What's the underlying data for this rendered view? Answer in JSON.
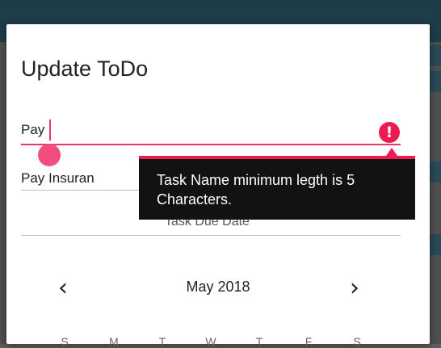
{
  "dialog": {
    "title": "Update ToDo",
    "task_name_value": "Pay",
    "task_description_value": "Pay Insuran",
    "due_date_label": "Task Due Date",
    "error_icon": "exclamation-icon",
    "error_tooltip_line1": "Task Name minimum legth is 5",
    "error_tooltip_line2": "Characters."
  },
  "calendar": {
    "month_label": "May 2018",
    "prev_icon": "chevron-left-icon",
    "next_icon": "chevron-right-icon",
    "weekdays": [
      "S",
      "M",
      "T",
      "W",
      "T",
      "F",
      "S"
    ]
  },
  "colors": {
    "accent": "#e8396e",
    "error": "#ec1c53",
    "tooltip_bg": "#121212",
    "appbar": "#1d3d49"
  }
}
